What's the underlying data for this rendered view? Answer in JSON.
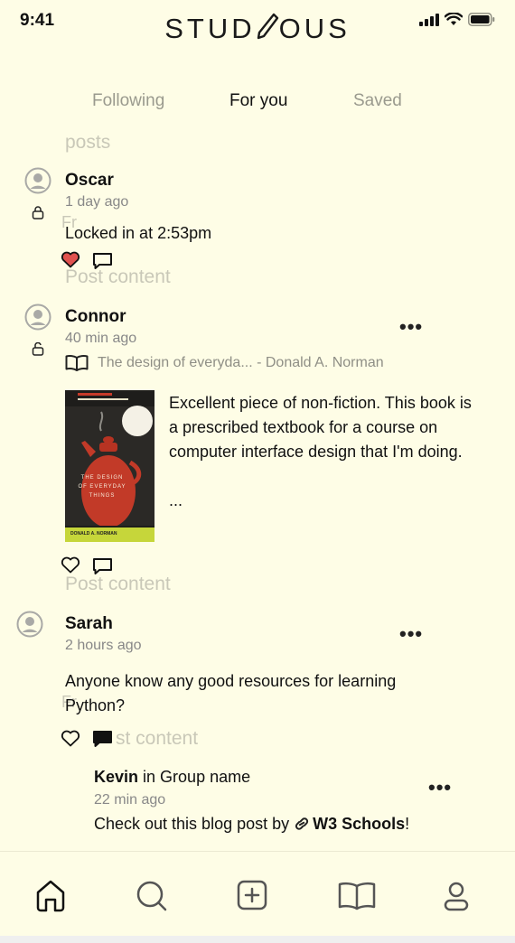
{
  "status": {
    "time": "9:41"
  },
  "app": {
    "logo_left": "STUD",
    "logo_right": "OUS"
  },
  "tabs": [
    {
      "label": "Following"
    },
    {
      "label": "For you"
    },
    {
      "label": "Saved"
    }
  ],
  "ghost_labels": {
    "posts": "posts",
    "post_content": "Post content",
    "post_content_partial": "st content",
    "fr": "Fr"
  },
  "posts": [
    {
      "user": "Oscar",
      "time": "1 day ago",
      "text": "Locked in at 2:53pm",
      "liked": true
    },
    {
      "user": "Connor",
      "time": "40 min ago",
      "book": "The design of everyda... - Donald A. Norman",
      "text": "Excellent piece of non-fiction. This book is a prescribed textbook for a course on computer interface design that I'm doing.",
      "ellipsis": "...",
      "cover": {
        "title": "THE DESIGN OF EVERYDAY THINGS",
        "author": "DONALD A. NORMAN"
      },
      "liked": false
    },
    {
      "user": "Sarah",
      "time": "2 hours ago",
      "text_line1": "Anyone know any good resources for learning",
      "text_line2": "Python?",
      "liked": false
    }
  ],
  "reply": {
    "user": "Kevin",
    "group_prefix": " in ",
    "group": "Group name",
    "time": "22 min ago",
    "text": "Check out this blog post by ",
    "link": "W3 Schools",
    "suffix": "!"
  },
  "more_label": "•••",
  "colors": {
    "background": "#fefde6",
    "heart": "#e0524f"
  }
}
